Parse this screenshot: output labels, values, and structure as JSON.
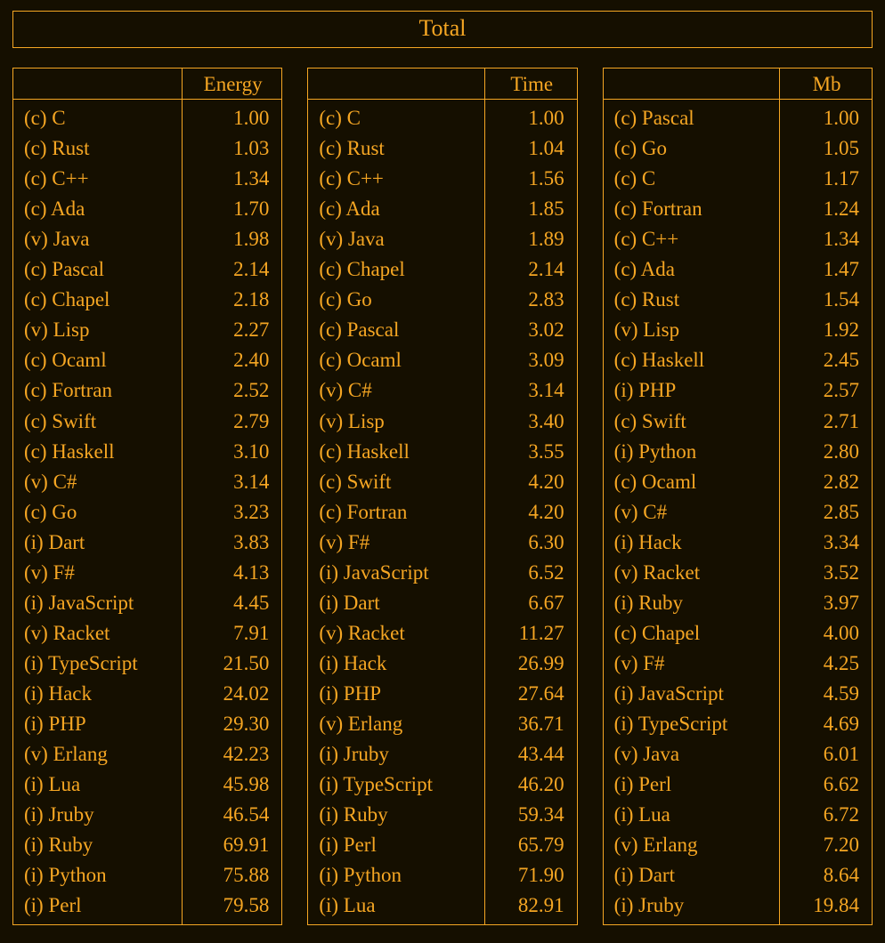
{
  "title": "Total",
  "columns": [
    {
      "metric": "Energy"
    },
    {
      "metric": "Time"
    },
    {
      "metric": "Mb"
    }
  ],
  "chart_data": {
    "type": "table",
    "title": "Total",
    "series": [
      {
        "name": "Energy",
        "rows": [
          {
            "lang": "(c) C",
            "value": "1.00"
          },
          {
            "lang": "(c) Rust",
            "value": "1.03"
          },
          {
            "lang": "(c) C++",
            "value": "1.34"
          },
          {
            "lang": "(c) Ada",
            "value": "1.70"
          },
          {
            "lang": "(v) Java",
            "value": "1.98"
          },
          {
            "lang": "(c) Pascal",
            "value": "2.14"
          },
          {
            "lang": "(c) Chapel",
            "value": "2.18"
          },
          {
            "lang": "(v) Lisp",
            "value": "2.27"
          },
          {
            "lang": "(c) Ocaml",
            "value": "2.40"
          },
          {
            "lang": "(c) Fortran",
            "value": "2.52"
          },
          {
            "lang": "(c) Swift",
            "value": "2.79"
          },
          {
            "lang": "(c) Haskell",
            "value": "3.10"
          },
          {
            "lang": "(v) C#",
            "value": "3.14"
          },
          {
            "lang": "(c) Go",
            "value": "3.23"
          },
          {
            "lang": "(i) Dart",
            "value": "3.83"
          },
          {
            "lang": "(v) F#",
            "value": "4.13"
          },
          {
            "lang": "(i) JavaScript",
            "value": "4.45"
          },
          {
            "lang": "(v) Racket",
            "value": "7.91"
          },
          {
            "lang": "(i) TypeScript",
            "value": "21.50"
          },
          {
            "lang": "(i) Hack",
            "value": "24.02"
          },
          {
            "lang": "(i) PHP",
            "value": "29.30"
          },
          {
            "lang": "(v) Erlang",
            "value": "42.23"
          },
          {
            "lang": "(i) Lua",
            "value": "45.98"
          },
          {
            "lang": "(i) Jruby",
            "value": "46.54"
          },
          {
            "lang": "(i) Ruby",
            "value": "69.91"
          },
          {
            "lang": "(i) Python",
            "value": "75.88"
          },
          {
            "lang": "(i) Perl",
            "value": "79.58"
          }
        ]
      },
      {
        "name": "Time",
        "rows": [
          {
            "lang": "(c) C",
            "value": "1.00"
          },
          {
            "lang": "(c) Rust",
            "value": "1.04"
          },
          {
            "lang": "(c) C++",
            "value": "1.56"
          },
          {
            "lang": "(c) Ada",
            "value": "1.85"
          },
          {
            "lang": "(v) Java",
            "value": "1.89"
          },
          {
            "lang": "(c) Chapel",
            "value": "2.14"
          },
          {
            "lang": "(c) Go",
            "value": "2.83"
          },
          {
            "lang": "(c) Pascal",
            "value": "3.02"
          },
          {
            "lang": "(c) Ocaml",
            "value": "3.09"
          },
          {
            "lang": "(v) C#",
            "value": "3.14"
          },
          {
            "lang": "(v) Lisp",
            "value": "3.40"
          },
          {
            "lang": "(c) Haskell",
            "value": "3.55"
          },
          {
            "lang": "(c) Swift",
            "value": "4.20"
          },
          {
            "lang": "(c) Fortran",
            "value": "4.20"
          },
          {
            "lang": "(v) F#",
            "value": "6.30"
          },
          {
            "lang": "(i) JavaScript",
            "value": "6.52"
          },
          {
            "lang": "(i) Dart",
            "value": "6.67"
          },
          {
            "lang": "(v) Racket",
            "value": "11.27"
          },
          {
            "lang": "(i) Hack",
            "value": "26.99"
          },
          {
            "lang": "(i) PHP",
            "value": "27.64"
          },
          {
            "lang": "(v) Erlang",
            "value": "36.71"
          },
          {
            "lang": "(i) Jruby",
            "value": "43.44"
          },
          {
            "lang": "(i) TypeScript",
            "value": "46.20"
          },
          {
            "lang": "(i) Ruby",
            "value": "59.34"
          },
          {
            "lang": "(i) Perl",
            "value": "65.79"
          },
          {
            "lang": "(i) Python",
            "value": "71.90"
          },
          {
            "lang": "(i) Lua",
            "value": "82.91"
          }
        ]
      },
      {
        "name": "Mb",
        "rows": [
          {
            "lang": "(c) Pascal",
            "value": "1.00"
          },
          {
            "lang": "(c) Go",
            "value": "1.05"
          },
          {
            "lang": "(c) C",
            "value": "1.17"
          },
          {
            "lang": "(c) Fortran",
            "value": "1.24"
          },
          {
            "lang": "(c) C++",
            "value": "1.34"
          },
          {
            "lang": "(c) Ada",
            "value": "1.47"
          },
          {
            "lang": "(c) Rust",
            "value": "1.54"
          },
          {
            "lang": "(v) Lisp",
            "value": "1.92"
          },
          {
            "lang": "(c) Haskell",
            "value": "2.45"
          },
          {
            "lang": "(i) PHP",
            "value": "2.57"
          },
          {
            "lang": "(c) Swift",
            "value": "2.71"
          },
          {
            "lang": "(i) Python",
            "value": "2.80"
          },
          {
            "lang": "(c) Ocaml",
            "value": "2.82"
          },
          {
            "lang": "(v) C#",
            "value": "2.85"
          },
          {
            "lang": "(i) Hack",
            "value": "3.34"
          },
          {
            "lang": "(v) Racket",
            "value": "3.52"
          },
          {
            "lang": "(i) Ruby",
            "value": "3.97"
          },
          {
            "lang": "(c) Chapel",
            "value": "4.00"
          },
          {
            "lang": "(v) F#",
            "value": "4.25"
          },
          {
            "lang": "(i) JavaScript",
            "value": "4.59"
          },
          {
            "lang": "(i) TypeScript",
            "value": "4.69"
          },
          {
            "lang": "(v) Java",
            "value": "6.01"
          },
          {
            "lang": "(i) Perl",
            "value": "6.62"
          },
          {
            "lang": "(i) Lua",
            "value": "6.72"
          },
          {
            "lang": "(v) Erlang",
            "value": "7.20"
          },
          {
            "lang": "(i) Dart",
            "value": "8.64"
          },
          {
            "lang": "(i) Jruby",
            "value": "19.84"
          }
        ]
      }
    ]
  }
}
